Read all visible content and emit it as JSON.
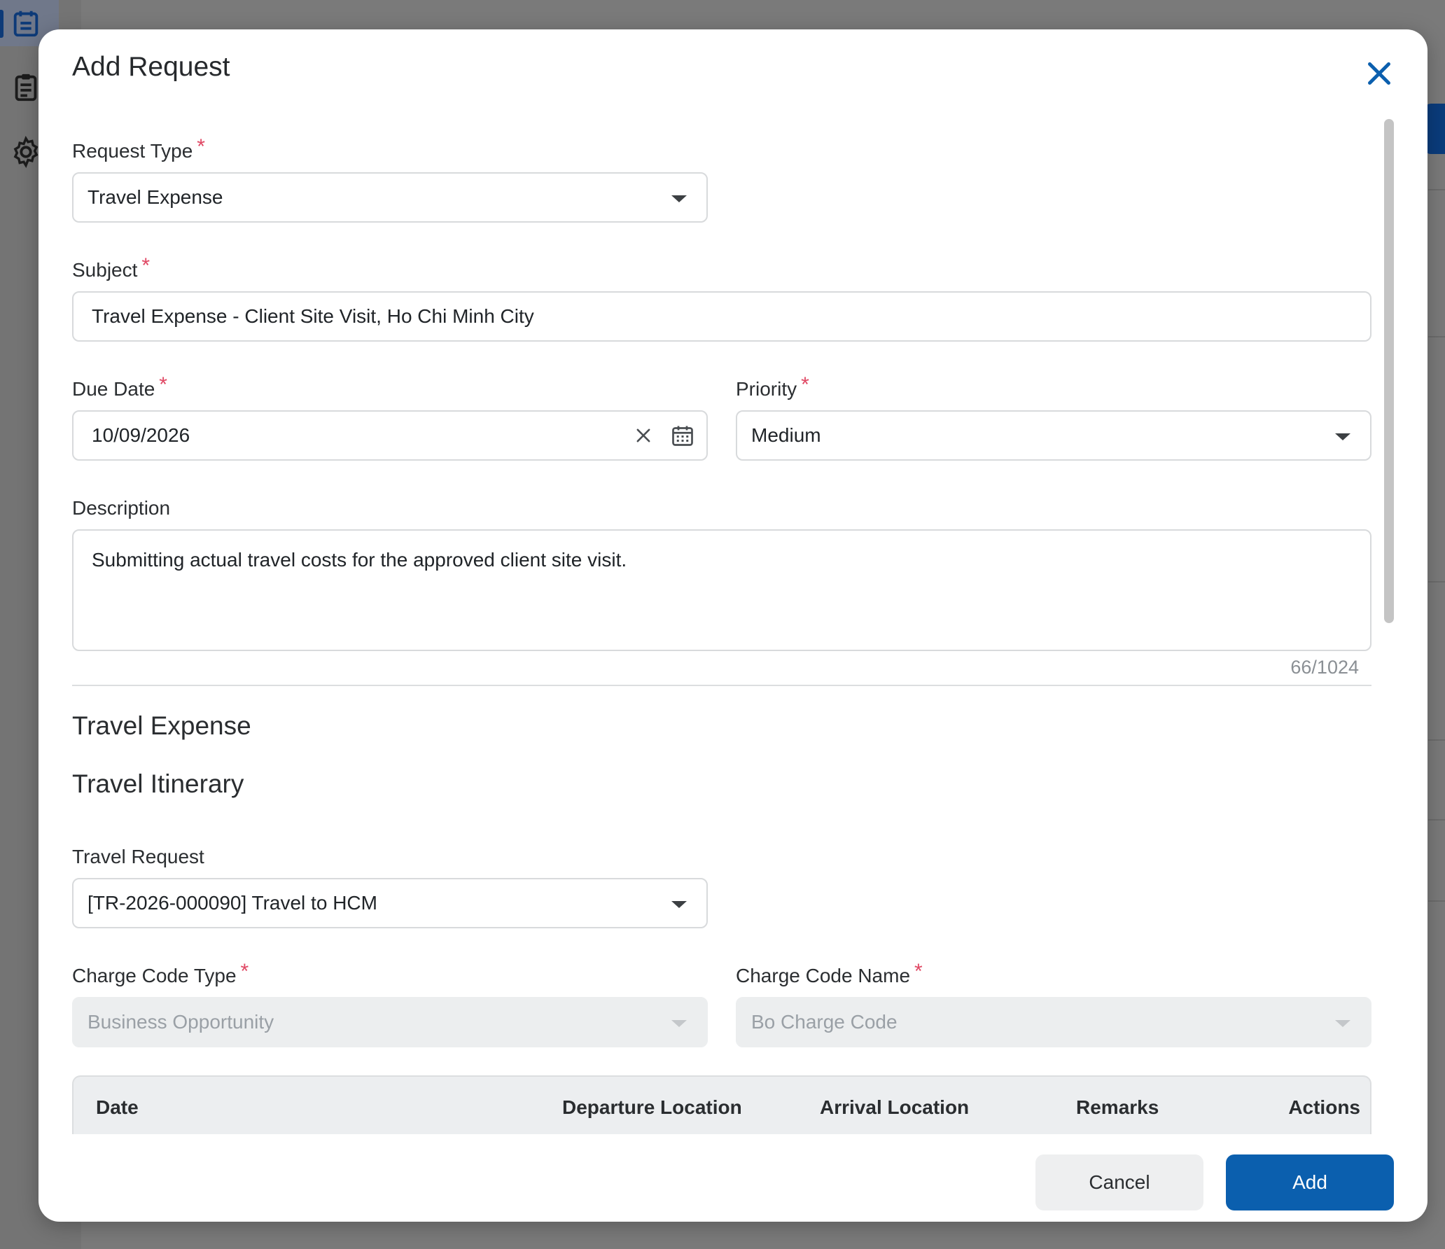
{
  "modal": {
    "title": "Add Request",
    "close_icon": "close-icon",
    "footer": {
      "cancel_label": "Cancel",
      "add_label": "Add"
    }
  },
  "form": {
    "request_type": {
      "label": "Request Type",
      "required": "*",
      "value": "Travel Expense"
    },
    "subject": {
      "label": "Subject",
      "required": "*",
      "value": "Travel Expense - Client Site Visit, Ho Chi Minh City"
    },
    "due_date": {
      "label": "Due Date",
      "required": "*",
      "value": "10/09/2026"
    },
    "priority": {
      "label": "Priority",
      "required": "*",
      "value": "Medium"
    },
    "description": {
      "label": "Description",
      "value": "Submitting actual travel costs for the approved client site visit.",
      "counter": "66/1024"
    }
  },
  "travel_expense": {
    "section_title": "Travel Expense",
    "itinerary_title": "Travel Itinerary",
    "travel_request": {
      "label": "Travel Request",
      "value": "[TR-2026-000090] Travel to HCM"
    },
    "charge_code_type": {
      "label": "Charge Code Type",
      "required": "*",
      "value": "Business Opportunity"
    },
    "charge_code_name": {
      "label": "Charge Code Name",
      "required": "*",
      "value": "Bo Charge Code"
    },
    "table": {
      "columns": [
        "Date",
        "Departure Location",
        "Arrival Location",
        "Remarks",
        "Actions"
      ]
    }
  },
  "colors": {
    "primary": "#0b5fae",
    "required": "#e04864",
    "overlay": "#7a7a7a"
  }
}
